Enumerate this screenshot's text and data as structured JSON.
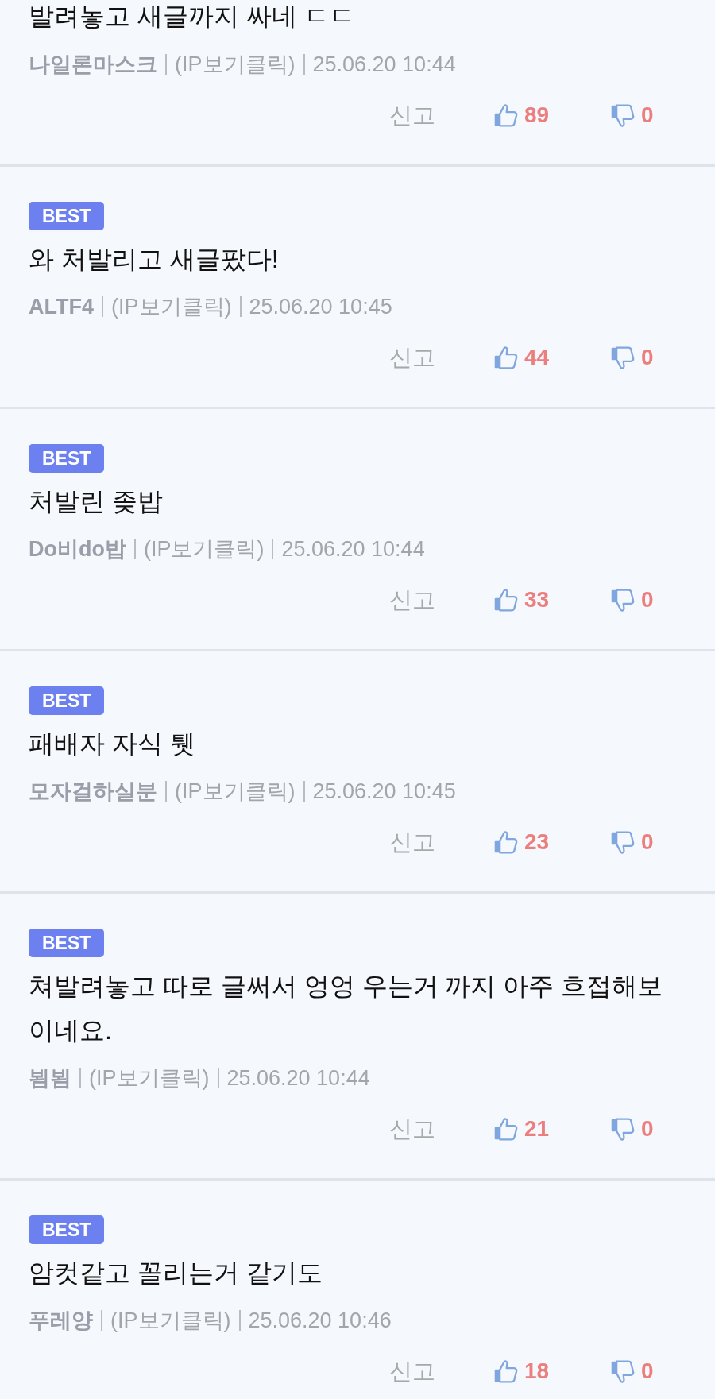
{
  "comments": [
    {
      "text": "발려놓고 새글까지 싸네 ㄷㄷ",
      "author": "나일론마스크",
      "ip_link": "(IP보기클릭)",
      "time": "25.06.20 10:44",
      "report": "신고",
      "likes": "89",
      "dislikes": "0"
    },
    {
      "badge": "BEST",
      "text": "와 처발리고 새글팠다!",
      "author": "ALTF4",
      "ip_link": "(IP보기클릭)",
      "time": "25.06.20 10:45",
      "report": "신고",
      "likes": "44",
      "dislikes": "0"
    },
    {
      "badge": "BEST",
      "text": "처발린 좆밥",
      "author": "Do비do밥",
      "ip_link": "(IP보기클릭)",
      "time": "25.06.20 10:44",
      "report": "신고",
      "likes": "33",
      "dislikes": "0"
    },
    {
      "badge": "BEST",
      "text": "패배자 자식 퉷",
      "author": "모자걸하실분",
      "ip_link": "(IP보기클릭)",
      "time": "25.06.20 10:45",
      "report": "신고",
      "likes": "23",
      "dislikes": "0"
    },
    {
      "badge": "BEST",
      "text": "쳐발려놓고 따로 글써서 엉엉 우는거 까지 아주 흐접해보이네요.",
      "author": "뵘뵘",
      "ip_link": "(IP보기클릭)",
      "time": "25.06.20 10:44",
      "report": "신고",
      "likes": "21",
      "dislikes": "0"
    },
    {
      "badge": "BEST",
      "text": "암컷같고 꼴리는거 같기도",
      "author": "푸레양",
      "ip_link": "(IP보기클릭)",
      "time": "25.06.20 10:46",
      "report": "신고",
      "likes": "18",
      "dislikes": "0"
    }
  ]
}
